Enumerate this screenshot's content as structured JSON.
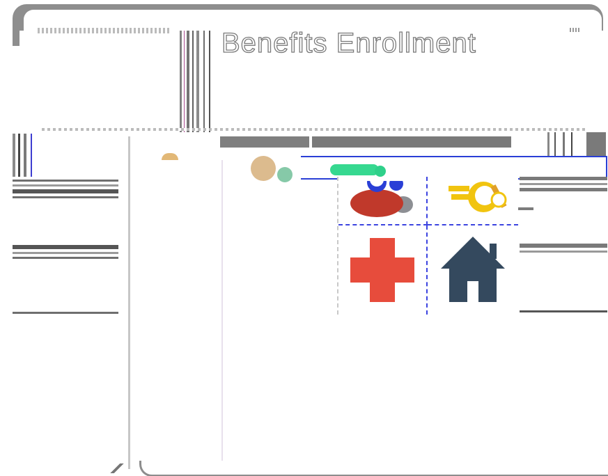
{
  "window": {
    "title": "Benefits Enrollment"
  },
  "benefits": {
    "tiles": [
      {
        "icon": "family-icon",
        "color": "#c0392b"
      },
      {
        "icon": "keys-icon",
        "color": "#f1c40f"
      },
      {
        "icon": "medical-cross-icon",
        "color": "#e74c3c"
      },
      {
        "icon": "home-icon",
        "color": "#34495e"
      }
    ]
  },
  "colors": {
    "accent": "#2a3fd6",
    "frame": "#8e8e8e"
  }
}
